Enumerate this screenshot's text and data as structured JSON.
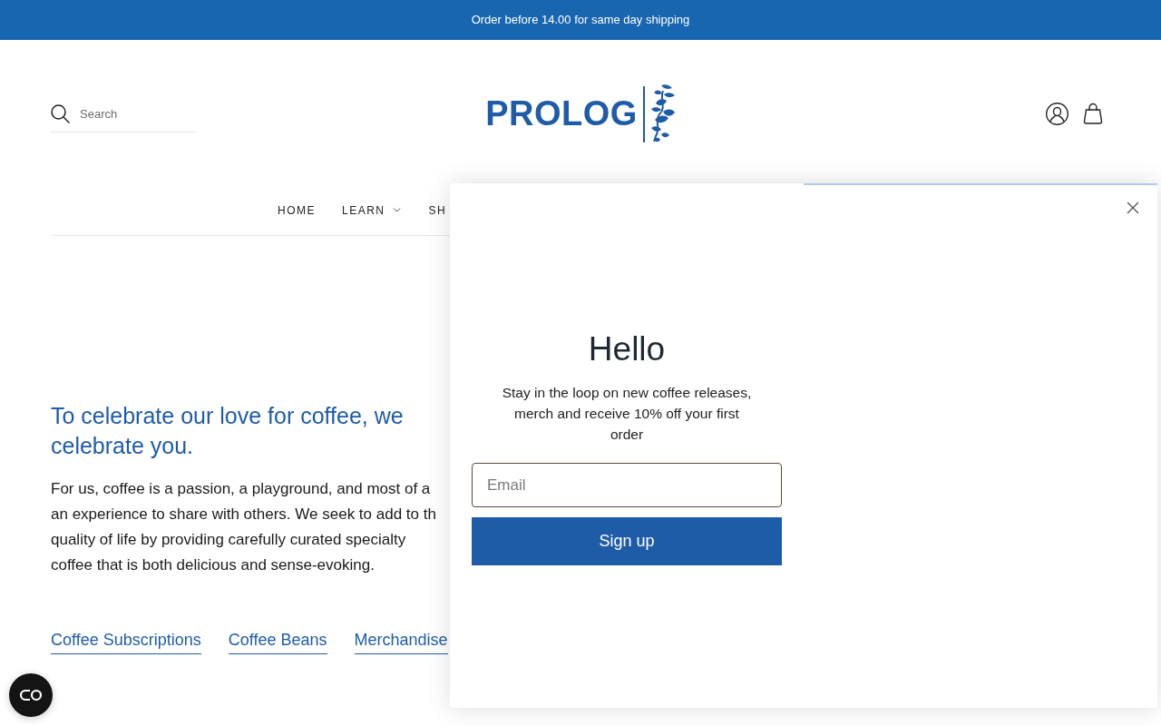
{
  "announcement_bar": {
    "text": "Order before 14.00 for same day shipping"
  },
  "header": {
    "search": {
      "placeholder": "Search"
    },
    "logo": {
      "text": "PROLOG"
    }
  },
  "nav": {
    "items": [
      {
        "label": "HOME",
        "has_menu": false
      },
      {
        "label": "LEARN",
        "has_menu": true
      },
      {
        "label": "SH",
        "has_menu": false
      }
    ]
  },
  "intro": {
    "heading": "To celebrate our love for coffee, we celebrate you.",
    "paragraph_lines": [
      "For us, coffee is a passion, a playground, and most of a",
      "an experience to share with others. We seek to add to th",
      "quality of life by providing carefully curated specialty",
      "coffee that is both delicious and sense-evoking."
    ]
  },
  "links": [
    {
      "label": "Coffee Subscriptions"
    },
    {
      "label": "Coffee Beans"
    },
    {
      "label": "Merchandise"
    }
  ],
  "popup": {
    "title": "Hello",
    "text": "Stay in the loop on new coffee releases, merch and receive 10% off your first order",
    "email": {
      "placeholder": "Email"
    },
    "button": "Sign up"
  }
}
